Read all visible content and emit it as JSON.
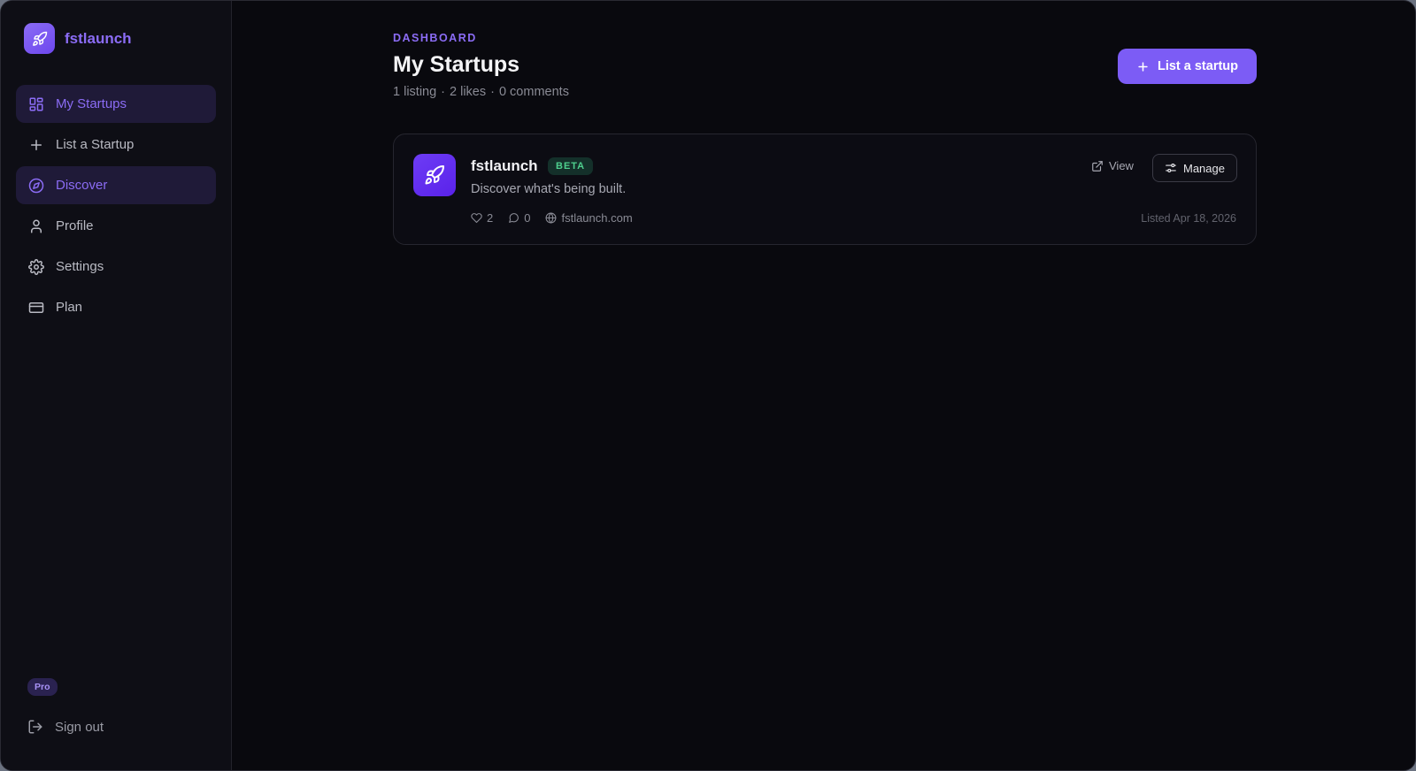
{
  "brand": {
    "name": "fstlaunch",
    "icon": "rocket-icon",
    "accent": "#8b6cf5"
  },
  "nav": {
    "items": [
      {
        "label": "My Startups",
        "icon": "grid-icon",
        "active": true
      },
      {
        "label": "List a Startup",
        "icon": "plus-icon",
        "active": false
      },
      {
        "label": "Discover",
        "icon": "compass-icon",
        "active": true
      },
      {
        "label": "Profile",
        "icon": "user-icon",
        "active": false
      },
      {
        "label": "Settings",
        "icon": "gear-icon",
        "active": false
      },
      {
        "label": "Plan",
        "icon": "credit-card-icon",
        "active": false
      }
    ]
  },
  "plan_badge": "Pro",
  "signout": {
    "label": "Sign out",
    "icon": "log-out-icon"
  },
  "header": {
    "eyebrow": "DASHBOARD",
    "title": "My Startups",
    "stats": [
      "1 listing",
      "·",
      "2 likes",
      "·",
      "0 comments"
    ],
    "primary_action": "List a startup"
  },
  "startups": [
    {
      "name": "fstlaunch",
      "badge": "BETA",
      "description": "Discover what's being built.",
      "likes": "2",
      "comments": "0",
      "website": "fstlaunch.com",
      "listed": "Listed Apr 18, 2026",
      "view_label": "View",
      "manage_label": "Manage"
    }
  ]
}
